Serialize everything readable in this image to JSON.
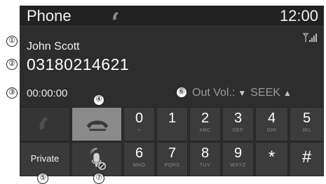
{
  "header": {
    "title": "Phone",
    "time": "12:00",
    "call_icon": "handset-icon",
    "signal_icon": "signal-strength-icon"
  },
  "call": {
    "name": "John Scott",
    "number": "03180214621",
    "timer": "00:00:00"
  },
  "volume": {
    "label": "Out Vol.:",
    "down_icon": "triangle-down-icon",
    "seek": "SEEK",
    "up_icon": "triangle-up-icon"
  },
  "buttons": {
    "accept_icon": "handset-icon",
    "end_icon": "end-call-icon",
    "private": "Private",
    "mute_icon": "mic-mute-icon"
  },
  "keypad": [
    {
      "num": "0",
      "sub": "+"
    },
    {
      "num": "1",
      "sub": ""
    },
    {
      "num": "2",
      "sub": "ABC"
    },
    {
      "num": "3",
      "sub": "DEF"
    },
    {
      "num": "4",
      "sub": "GHI"
    },
    {
      "num": "5",
      "sub": "JKL"
    },
    {
      "num": "6",
      "sub": "MNO"
    },
    {
      "num": "7",
      "sub": "PQRS"
    },
    {
      "num": "8",
      "sub": "TUV"
    },
    {
      "num": "9",
      "sub": "WXYZ"
    },
    {
      "num": "*",
      "sub": ""
    },
    {
      "num": "#",
      "sub": ""
    }
  ],
  "callouts": [
    "①",
    "②",
    "③",
    "④",
    "⑤",
    "⑥",
    "⑦"
  ],
  "colors": {
    "screen_bg": "#2d2d2d",
    "key_bg": "#3c3c3c",
    "end_key_bg": "#8a8a8a",
    "muted_text": "#9a9a9a"
  }
}
